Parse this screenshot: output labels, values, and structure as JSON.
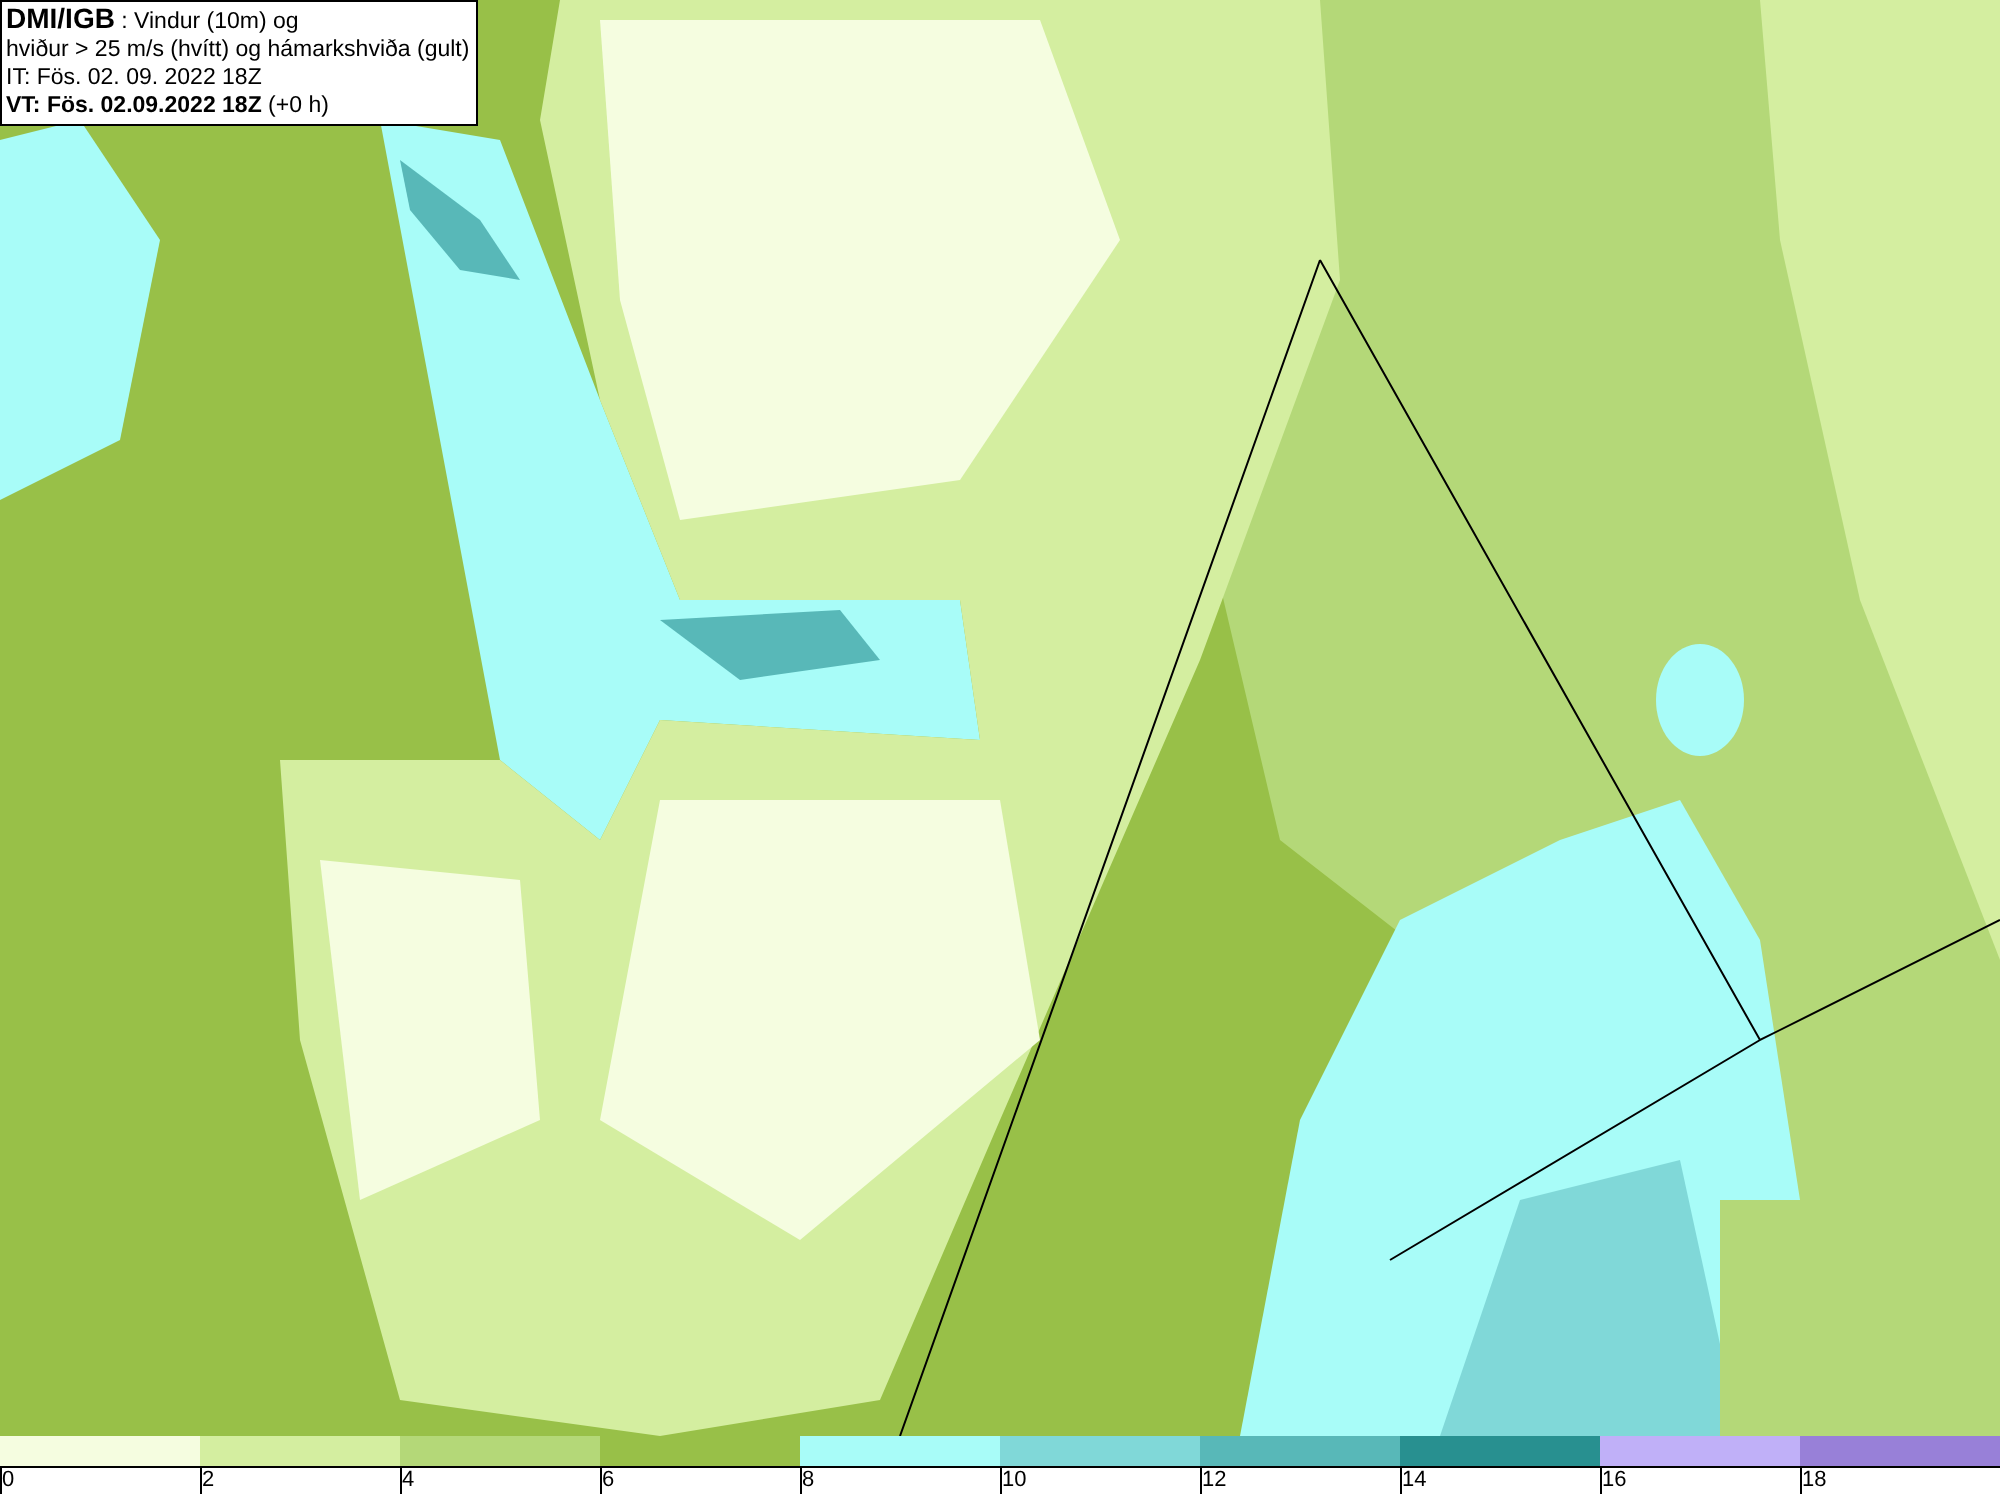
{
  "title_box": {
    "lines": [
      "**DMI/IGB** : Vindur (10m) og",
      "hviður > 25 m/s (hvítt) og hámarkshviða (gult)",
      "IT: Fös. 02. 09. 2022 18Z",
      "**VT: Fös. 02.09.2022 18Z** (+0 h)"
    ]
  },
  "legend": [
    {
      "label": "0",
      "color": "#f5fde0"
    },
    {
      "label": "2",
      "color": "#d4eea0"
    },
    {
      "label": "4",
      "color": "#b4d878"
    },
    {
      "label": "6",
      "color": "#98c048"
    },
    {
      "label": "8",
      "color": "#a8fcf8"
    },
    {
      "label": "10",
      "color": "#80d8d8"
    },
    {
      "label": "12",
      "color": "#58b8b8"
    },
    {
      "label": "14",
      "color": "#289090"
    },
    {
      "label": "16",
      "color": "#c0b0f8"
    },
    {
      "label": "18",
      "color": "#9880d8"
    }
  ]
}
